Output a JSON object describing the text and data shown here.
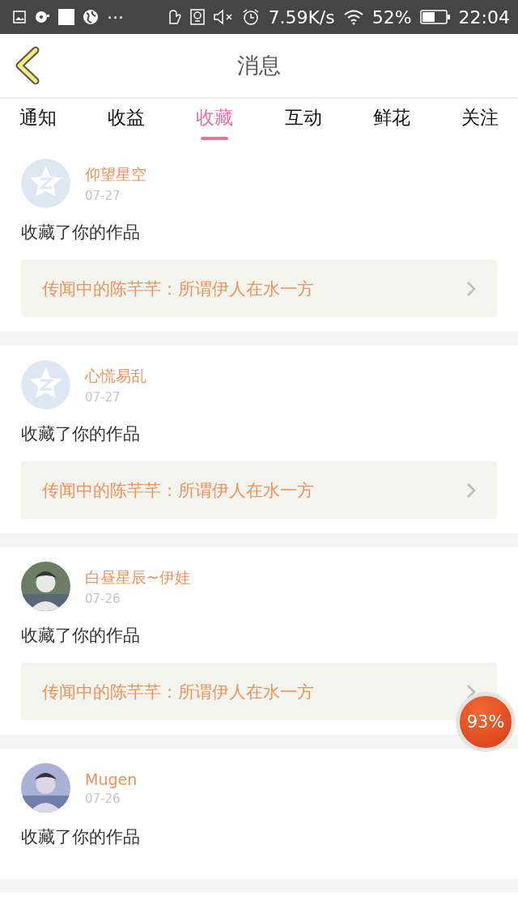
{
  "status_bar": {
    "more": "···",
    "speed": "7.59K/s",
    "battery": "52%",
    "time": "22:04"
  },
  "header": {
    "title": "消息"
  },
  "tabs": [
    {
      "label": "通知",
      "selected": false
    },
    {
      "label": "收益",
      "selected": false
    },
    {
      "label": "收藏",
      "selected": true
    },
    {
      "label": "互动",
      "selected": false
    },
    {
      "label": "鲜花",
      "selected": false
    },
    {
      "label": "关注",
      "selected": false
    }
  ],
  "messages": [
    {
      "user": "仰望星空",
      "date": "07-27",
      "avatar": {
        "kind": "default"
      },
      "text": "收藏了你的作品",
      "work": {
        "title": "传闻中的陈芊芊：所谓伊人在水一方"
      }
    },
    {
      "user": "心慌易乱",
      "date": "07-27",
      "avatar": {
        "kind": "default"
      },
      "text": "收藏了你的作品",
      "work": {
        "title": "传闻中的陈芊芊：所谓伊人在水一方"
      }
    },
    {
      "user": "白昼星辰~伊娃",
      "date": "07-26",
      "text": "收藏了你的作品",
      "work": {
        "title": "传闻中的陈芊芊：所谓伊人在水一方"
      }
    },
    {
      "user": "Mugen",
      "date": "07-26",
      "text": "收藏了你的作品"
    }
  ],
  "floating_badge": {
    "text": "93%"
  }
}
